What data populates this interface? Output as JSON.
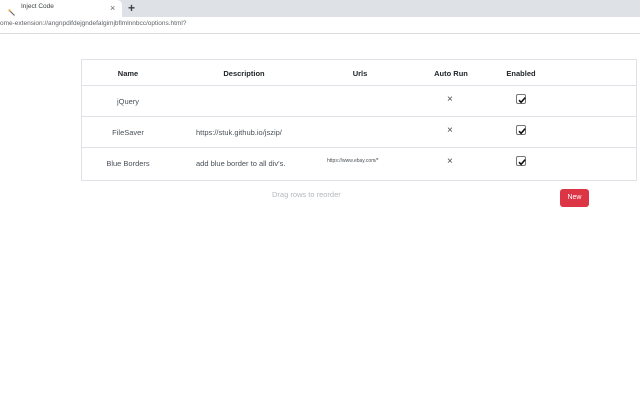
{
  "browser": {
    "tab_title": "Inject Code",
    "tab_close": "×",
    "new_tab": "+",
    "url": "ome-extension://angnpdifdejgndefalgimjbflmlnnbcc/options.html?"
  },
  "table": {
    "headers": {
      "name": "Name",
      "description": "Description",
      "urls": "Urls",
      "auto_run": "Auto Run",
      "enabled": "Enabled"
    },
    "rows": [
      {
        "name": "jQuery",
        "description": "",
        "urls": "",
        "auto_run": "×",
        "enabled": true
      },
      {
        "name": "FileSaver",
        "description": "https://stuk.github.io/jszip/",
        "urls": "",
        "auto_run": "×",
        "enabled": true
      },
      {
        "name": "Blue Borders",
        "description": "add blue border to all div's.",
        "urls": "https://www.ebay.com/*",
        "auto_run": "×",
        "enabled": true
      }
    ]
  },
  "footer": {
    "hint": "Drag rows to reorder",
    "new_label": "New"
  },
  "colors": {
    "accent_danger": "#dc3545",
    "border": "#dee2e6",
    "tabstrip": "#dee1e6"
  }
}
